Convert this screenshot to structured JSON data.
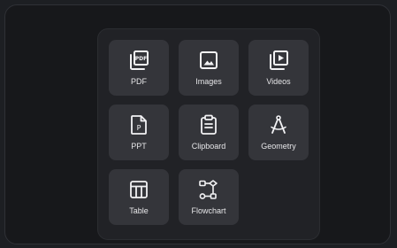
{
  "panel": {
    "tiles": [
      {
        "label": "PDF",
        "icon": "pdf-icon"
      },
      {
        "label": "Images",
        "icon": "image-icon"
      },
      {
        "label": "Videos",
        "icon": "video-icon"
      },
      {
        "label": "PPT",
        "icon": "ppt-icon"
      },
      {
        "label": "Clipboard",
        "icon": "clipboard-icon"
      },
      {
        "label": "Geometry",
        "icon": "compass-icon"
      },
      {
        "label": "Table",
        "icon": "table-icon"
      },
      {
        "label": "Flowchart",
        "icon": "flowchart-icon"
      }
    ]
  },
  "colors": {
    "background": "#1d1f23",
    "panel": "#212226",
    "tile": "#34353a",
    "icon": "#f2f2f4",
    "text": "#e6e6e8"
  }
}
